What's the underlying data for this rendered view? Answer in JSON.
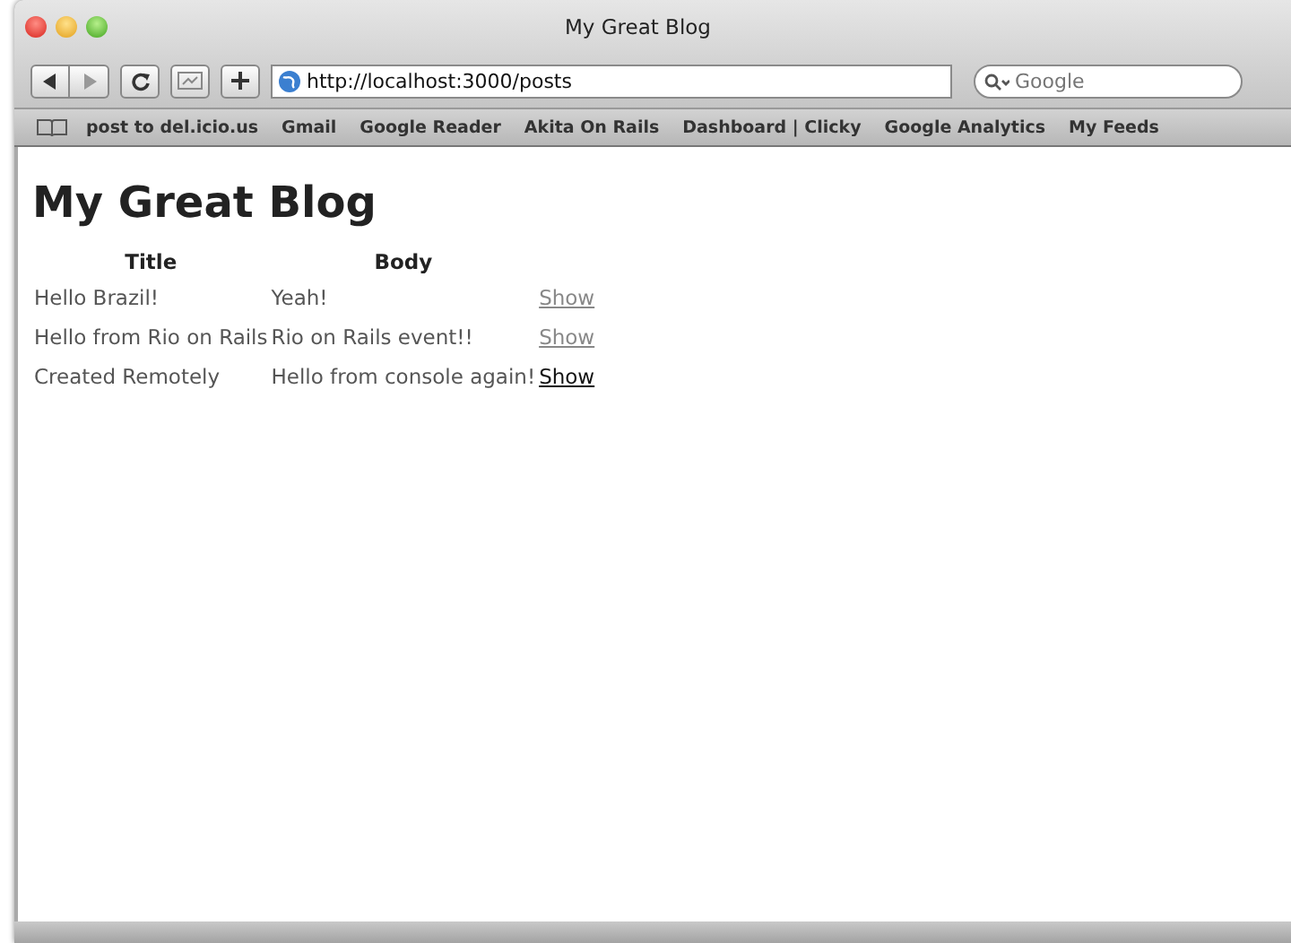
{
  "window": {
    "title": "My Great Blog"
  },
  "toolbar": {
    "url": "http://localhost:3000/posts",
    "search": {
      "placeholder": "Google"
    }
  },
  "bookmarks": [
    "post to del.icio.us",
    "Gmail",
    "Google Reader",
    "Akita On Rails",
    "Dashboard | Clicky",
    "Google Analytics",
    "My Feeds"
  ],
  "page": {
    "heading": "My Great Blog",
    "table": {
      "columns": [
        "Title",
        "Body"
      ],
      "rows": [
        {
          "title": "Hello Brazil!",
          "body": "Yeah!",
          "link": "Show",
          "visited": true
        },
        {
          "title": "Hello from Rio on Rails",
          "body": "Rio on Rails event!!",
          "link": "Show",
          "visited": true
        },
        {
          "title": "Created Remotely",
          "body": "Hello from console again!",
          "link": "Show",
          "visited": false
        }
      ]
    }
  }
}
